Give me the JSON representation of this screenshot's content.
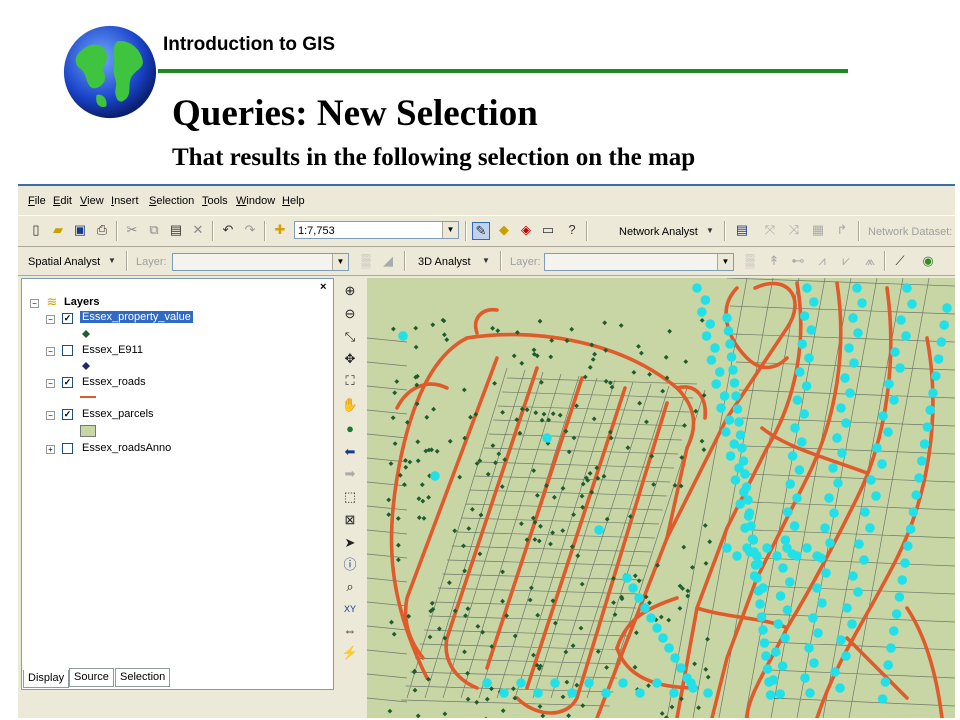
{
  "slide": {
    "course": "Introduction to GIS",
    "title": "Queries: New Selection",
    "subtitle": "That results in the following selection on the map"
  },
  "menu": [
    "File",
    "Edit",
    "View",
    "Insert",
    "Selection",
    "Tools",
    "Window",
    "Help"
  ],
  "toolbar": {
    "scale": "1:7,753",
    "network_analyst": "Network Analyst",
    "network_dataset": "Network Dataset:",
    "spatial_analyst": "Spatial Analyst",
    "analyst_3d": "3D Analyst",
    "layer_label": "Layer:",
    "layer_label2": "Layer:"
  },
  "toc": {
    "root": "Layers",
    "layers": [
      {
        "name": "Essex_property_value",
        "checked": true,
        "selected": true
      },
      {
        "name": "Essex_E911",
        "checked": false
      },
      {
        "name": "Essex_roads",
        "checked": true
      },
      {
        "name": "Essex_parcels",
        "checked": true
      },
      {
        "name": "Essex_roadsAnno",
        "checked": false
      }
    ],
    "tabs": [
      "Display",
      "Source",
      "Selection"
    ]
  },
  "colors": {
    "map_bg": "#c7d6a4",
    "road": "#e05a2b",
    "parcel_line": "#6f7a6b",
    "selected_point": "#22e0e8",
    "unselected_point": "#1e5c2c",
    "accent_rule": "#1e8a1e"
  }
}
